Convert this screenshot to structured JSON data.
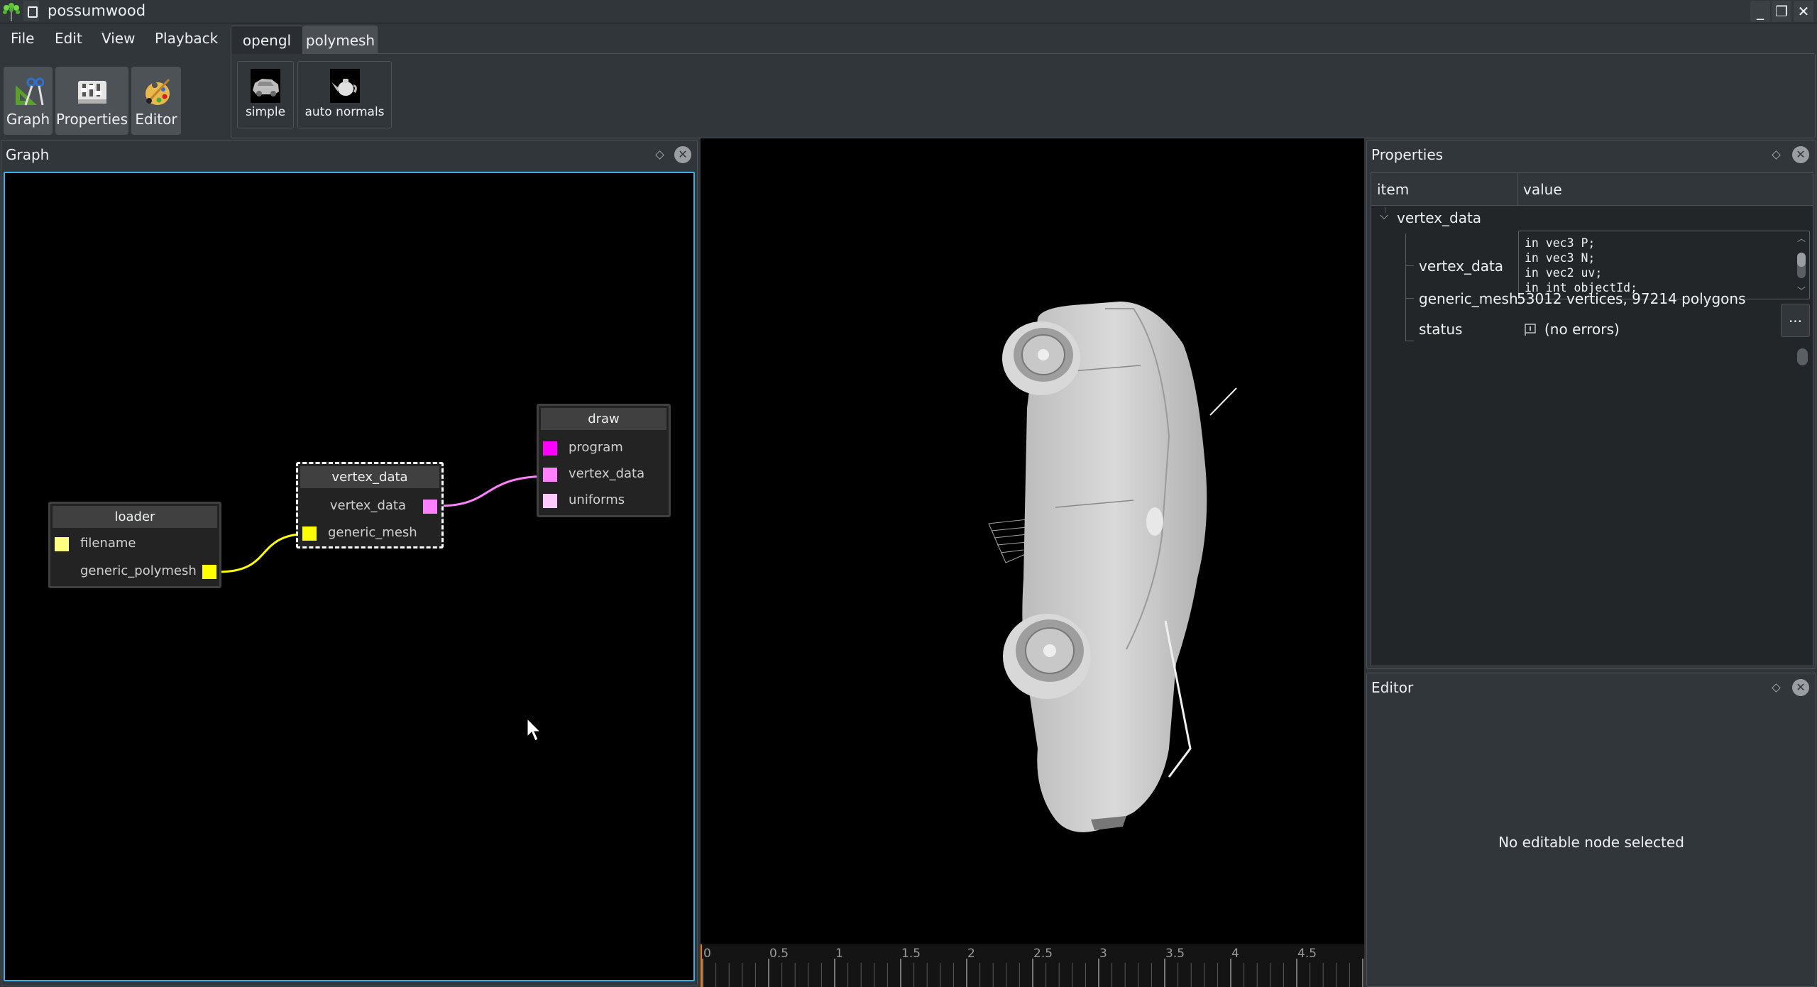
{
  "window": {
    "title": "possumwood",
    "controls": {
      "minimize": "_",
      "maximize": "❐",
      "close": "✕"
    }
  },
  "menubar": {
    "items": [
      {
        "label": "File"
      },
      {
        "label": "Edit"
      },
      {
        "label": "View"
      },
      {
        "label": "Playback"
      }
    ]
  },
  "toolbar": {
    "buttons": [
      {
        "label": "Graph",
        "icon": "graph-tools-icon"
      },
      {
        "label": "Properties",
        "icon": "properties-sliders-icon"
      },
      {
        "label": "Editor",
        "icon": "palette-icon"
      }
    ]
  },
  "tabs": [
    {
      "label": "opengl",
      "active": false
    },
    {
      "label": "polymesh",
      "active": true
    }
  ],
  "presets": [
    {
      "label": "simple",
      "icon": "car-thumbnail-icon"
    },
    {
      "label": "auto normals",
      "icon": "teapot-thumbnail-icon"
    }
  ],
  "graph_dock": {
    "title": "Graph",
    "nodes": [
      {
        "name": "loader",
        "selected": false,
        "inputs": [
          {
            "label": "filename",
            "color": "#ffff80"
          }
        ],
        "outputs": [
          {
            "label": "generic_polymesh",
            "color": "#ffff00"
          }
        ]
      },
      {
        "name": "vertex_data",
        "selected": true,
        "outputs": [
          {
            "label": "vertex_data",
            "color": "#ff80ff"
          }
        ],
        "inputs": [
          {
            "label": "generic_mesh",
            "color": "#ffff00"
          }
        ]
      },
      {
        "name": "draw",
        "selected": false,
        "inputs": [
          {
            "label": "program",
            "color": "#ff00ff"
          },
          {
            "label": "vertex_data",
            "color": "#ff80ff"
          },
          {
            "label": "uniforms",
            "color": "#ffc8ff"
          }
        ]
      }
    ],
    "connections": [
      {
        "from": "loader.generic_polymesh",
        "to": "vertex_data.generic_mesh",
        "color": "#ffff00"
      },
      {
        "from": "vertex_data.vertex_data",
        "to": "draw.vertex_data",
        "color": "#ff80ff"
      }
    ]
  },
  "viewport": {
    "description": "3D render of car model (white shaded)"
  },
  "timeline": {
    "ticks": [
      "0",
      "0.5",
      "1",
      "1.5",
      "2",
      "2.5",
      "3",
      "3.5",
      "4",
      "4.5"
    ],
    "playhead_color": "#f67400",
    "current_time": 0
  },
  "properties_dock": {
    "title": "Properties",
    "columns": {
      "item": "item",
      "value": "value"
    },
    "node": "vertex_data",
    "rows": [
      {
        "item": "vertex_data",
        "value_lines": [
          "in vec3 P;",
          "in vec3 N;",
          "in vec2 uv;",
          "in int objectId;"
        ]
      },
      {
        "item": "generic_mesh",
        "value": "53012 vertices, 97214 polygons",
        "button": "..."
      },
      {
        "item": "status",
        "value": "(no errors)"
      }
    ]
  },
  "editor_dock": {
    "title": "Editor",
    "message": "No editable node selected"
  },
  "colors": {
    "accent": "#3daee9",
    "window_bg": "#31363b",
    "panel_dark": "#232629"
  }
}
